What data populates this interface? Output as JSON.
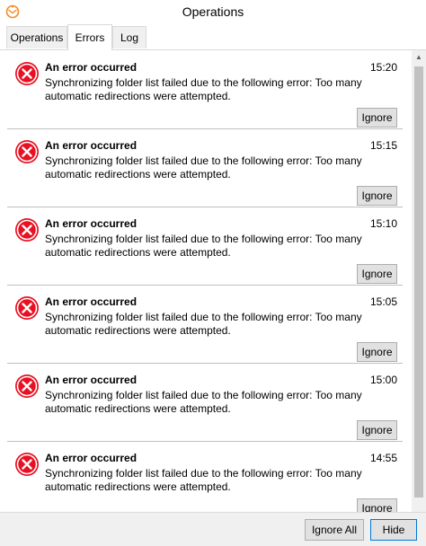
{
  "window": {
    "title": "Operations"
  },
  "tabs": [
    {
      "label": "Operations",
      "active": false
    },
    {
      "label": "Errors",
      "active": true
    },
    {
      "label": "Log",
      "active": false
    }
  ],
  "errors": [
    {
      "title": "An error occurred",
      "time": "15:20",
      "message": "Synchronizing folder list failed due to the following error: Too many automatic redirections were attempted.",
      "button": "Ignore"
    },
    {
      "title": "An error occurred",
      "time": "15:15",
      "message": "Synchronizing folder list failed due to the following error: Too many automatic redirections were attempted.",
      "button": "Ignore"
    },
    {
      "title": "An error occurred",
      "time": "15:10",
      "message": "Synchronizing folder list failed due to the following error: Too many automatic redirections were attempted.",
      "button": "Ignore"
    },
    {
      "title": "An error occurred",
      "time": "15:05",
      "message": "Synchronizing folder list failed due to the following error: Too many automatic redirections were attempted.",
      "button": "Ignore"
    },
    {
      "title": "An error occurred",
      "time": "15:00",
      "message": "Synchronizing folder list failed due to the following error: Too many automatic redirections were attempted.",
      "button": "Ignore"
    },
    {
      "title": "An error occurred",
      "time": "14:55",
      "message": "Synchronizing folder list failed due to the following error: Too many automatic redirections were attempted.",
      "button": "Ignore"
    }
  ],
  "footer": {
    "ignore_all_label": "Ignore All",
    "hide_label": "Hide"
  },
  "colors": {
    "error_red": "#e81123",
    "accent_blue": "#0078d7",
    "app_icon_orange": "#f28c28"
  },
  "icons": {
    "app": "envelope-clock-icon",
    "error": "error-circle-x-icon",
    "scroll_up": "scroll-up-arrow-icon"
  }
}
